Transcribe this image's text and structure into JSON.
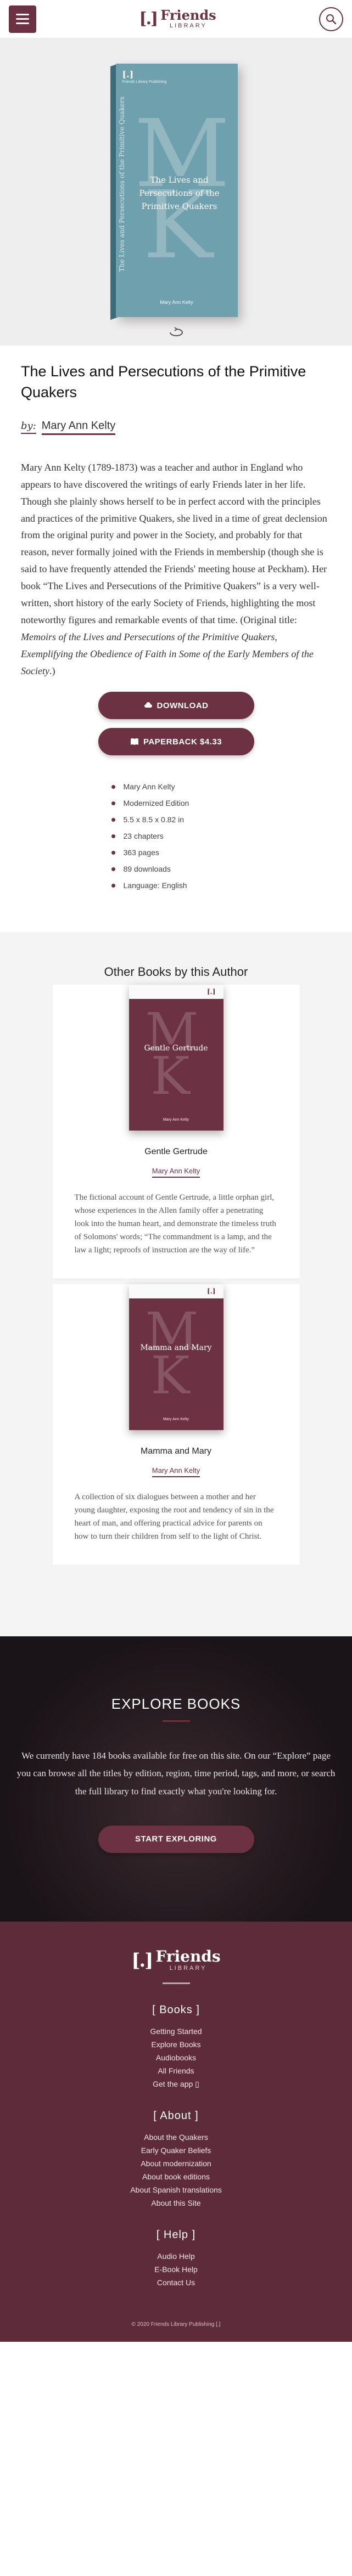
{
  "header": {
    "logo_mark": "[.]",
    "logo_title": "Friends",
    "logo_sub": "LIBRARY"
  },
  "book": {
    "cover_publisher": "Friends Library Publishing",
    "cover_spine": "The Lives and Persecutions of the Primitive Quakers",
    "cover_title": "The Lives and Persecutions of the Primitive Quakers",
    "cover_author": "Mary Ann Kelty",
    "cover_letter_1": "M",
    "cover_letter_2": "K",
    "title": "The Lives and Persecutions of the Primitive Quakers",
    "by_label": "by:",
    "author": "Mary Ann Kelty",
    "description": "Mary Ann Kelty (1789-1873) was a teacher and author in England who appears to have discovered the writings of early Friends later in her life. Though she plainly shows herself to be in perfect accord with the principles and practices of the primitive Quakers, she lived in a time of great declension from the original purity and power in the Society, and probably for that reason, never formally joined with the Friends in membership (though she is said to have frequently attended the Friends' meeting house at Peckham). Her book “The Lives and Persecutions of the Primitive Quakers” is a very well-written, short history of the early Society of Friends, highlighting the most noteworthy figures and remarkable events of that time. (Original title: ",
    "description_italic": "Memoirs of the Lives and Persecutions of the Primitive Quakers, Exemplifying the Obedience of Faith in Some of the Early Members of the Society",
    "description_end": ".)",
    "download_label": "Download",
    "paperback_label": "Paperback $4.33",
    "details": [
      "Mary Ann Kelty",
      "Modernized Edition",
      "5.5 x 8.5 x 0.82 in",
      "23 chapters",
      "363 pages",
      "89 downloads",
      "Language: English"
    ]
  },
  "other_books": {
    "heading": "Other Books by this Author",
    "items": [
      {
        "cover_title": "Gentle Gertrude",
        "title": "Gentle Gertrude",
        "author": "Mary Ann Kelty",
        "description": "The fictional account of Gentle Gertrude, a little orphan girl, whose experiences in the Allen family offer a penetrating look into the human heart, and demonstrate the timeless truth of Solomons' words; “The commandment is a lamp, and the law a light; reproofs of instruction are the way of life.”"
      },
      {
        "cover_title": "Mamma and Mary",
        "title": "Mamma and Mary",
        "author": "Mary Ann Kelty",
        "description": "A collection of six dialogues between a mother and her young daughter, exposing the root and tendency of sin in the heart of man, and offering practical advice for parents on how to turn their children from self to the light of Christ."
      }
    ]
  },
  "explore": {
    "heading": "Explore Books",
    "text": "We currently have 184 books available for free on this site. On our “Explore” page you can browse all the titles by edition, region, time period, tags, and more, or search the full library to find exactly what you're looking for.",
    "button": "Start Exploring"
  },
  "footer": {
    "sections": [
      {
        "heading": "[ Books ]",
        "links": [
          "Getting Started",
          "Explore Books",
          "Audiobooks",
          "All Friends",
          "Get the app"
        ]
      },
      {
        "heading": "[ About ]",
        "links": [
          "About the Quakers",
          "Early Quaker Beliefs",
          "About modernization",
          "About book editions",
          "About Spanish translations",
          "About this Site"
        ]
      },
      {
        "heading": "[ Help ]",
        "links": [
          "Audio Help",
          "E-Book Help",
          "Contact Us"
        ]
      }
    ],
    "copyright": "© 2020 Friends Library Publishing"
  }
}
